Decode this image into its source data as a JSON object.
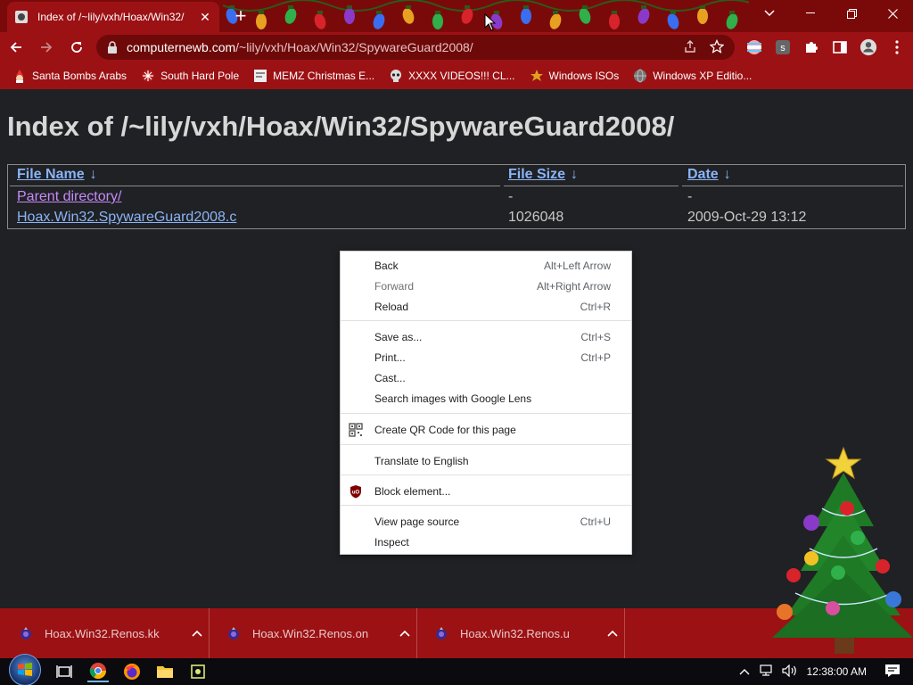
{
  "browser": {
    "tab": {
      "title": "Index of /~lily/vxh/Hoax/Win32/"
    },
    "address": {
      "host": "computernewb.com",
      "path": "/~lily/vxh/Hoax/Win32/SpywareGuard2008/"
    },
    "bookmarks": [
      {
        "label": "Santa Bombs Arabs",
        "icon": "santa-icon"
      },
      {
        "label": "South Hard Pole",
        "icon": "snowflake-icon"
      },
      {
        "label": "MEMZ Christmas E...",
        "icon": "page-icon"
      },
      {
        "label": "XXXX VIDEOS!!! CL...",
        "icon": "skull-icon"
      },
      {
        "label": "Windows ISOs",
        "icon": "folder-icon"
      },
      {
        "label": "Windows XP Editio...",
        "icon": "globe-icon"
      }
    ],
    "theme": {
      "frame": "#7a0a0a",
      "toolbar": "#9c1114",
      "omnibox": "#6e0909"
    }
  },
  "page": {
    "heading": "Index of /~lily/vxh/Hoax/Win32/SpywareGuard2008/",
    "columns": [
      {
        "label": "File Name",
        "sort": "↓"
      },
      {
        "label": "File Size",
        "sort": "↓"
      },
      {
        "label": "Date",
        "sort": "↓"
      }
    ],
    "rows": [
      {
        "name": "Parent directory/",
        "size": "-",
        "date": "-"
      },
      {
        "name": "Hoax.Win32.SpywareGuard2008.c",
        "size": "1026048",
        "date": "2009-Oct-29 13:12"
      }
    ]
  },
  "context_menu": {
    "items": [
      {
        "label": "Back",
        "shortcut": "Alt+Left Arrow"
      },
      {
        "label": "Forward",
        "shortcut": "Alt+Right Arrow",
        "disabled": true
      },
      {
        "label": "Reload",
        "shortcut": "Ctrl+R"
      },
      {
        "label": "Save as...",
        "shortcut": "Ctrl+S"
      },
      {
        "label": "Print...",
        "shortcut": "Ctrl+P"
      },
      {
        "label": "Cast...",
        "shortcut": ""
      },
      {
        "label": "Search images with Google Lens",
        "shortcut": ""
      },
      {
        "label": "Create QR Code for this page",
        "shortcut": "",
        "icon": "qr-code-icon"
      },
      {
        "label": "Translate to English",
        "shortcut": ""
      },
      {
        "label": "Block element...",
        "shortcut": "",
        "icon": "ublock-icon"
      },
      {
        "label": "View page source",
        "shortcut": "Ctrl+U"
      },
      {
        "label": "Inspect",
        "shortcut": ""
      }
    ]
  },
  "downloads": [
    {
      "name": "Hoax.Win32.Renos.kk"
    },
    {
      "name": "Hoax.Win32.Renos.on"
    },
    {
      "name": "Hoax.Win32.Renos.u"
    }
  ],
  "taskbar": {
    "clock": "12:38:00 AM",
    "apps": [
      "task-view-icon",
      "chrome-icon",
      "firefox-icon",
      "file-explorer-icon",
      "app-icon"
    ]
  }
}
